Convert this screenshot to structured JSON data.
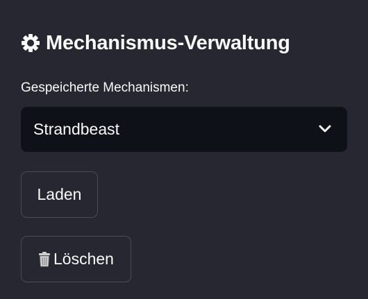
{
  "panel": {
    "title": "Mechanismus-Verwaltung",
    "title_icon": "gear-icon"
  },
  "mechanism_select": {
    "label": "Gespeicherte Mechanismen:",
    "selected_value": "Strandbeast",
    "dropdown_icon": "chevron-down-icon"
  },
  "buttons": {
    "load_label": "Laden",
    "delete_label": "Löschen",
    "delete_icon": "trash-icon"
  },
  "colors": {
    "background": "#262730",
    "select_background": "#0e1117",
    "text": "#fafafa",
    "button_border": "#4a4b56"
  }
}
